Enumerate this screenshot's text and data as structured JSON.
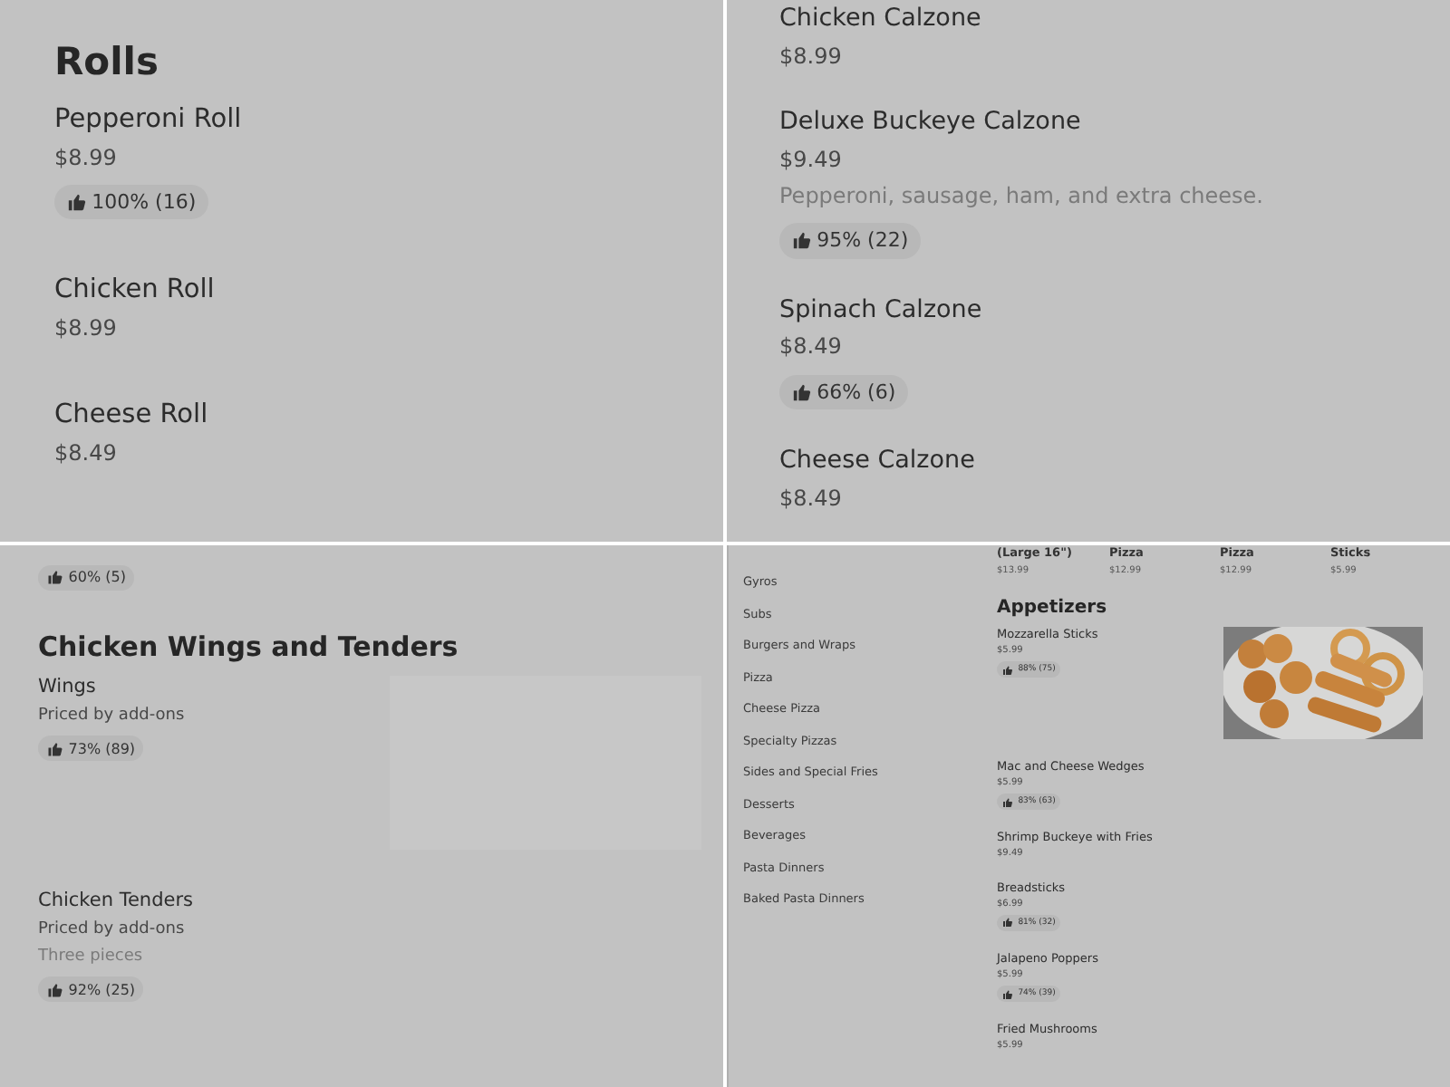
{
  "panels": [
    {
      "kind": "menu",
      "sections": [
        {
          "heading": "Rolls",
          "items": [
            {
              "name": "Pepperoni Roll",
              "price": "$8.99",
              "rating": "100% (16)"
            },
            {
              "name": "Chicken Roll",
              "price": "$8.99"
            },
            {
              "name": "Cheese Roll",
              "price": "$8.49"
            }
          ]
        }
      ]
    },
    {
      "kind": "menu",
      "sections": [
        {
          "items": [
            {
              "name": "Chicken Calzone",
              "price": "$8.99"
            },
            {
              "name": "Deluxe Buckeye Calzone",
              "price": "$9.49",
              "description": "Pepperoni, sausage, ham, and extra cheese.",
              "rating": "95% (22)"
            },
            {
              "name": "Spinach Calzone",
              "price": "$8.49",
              "rating": "66% (6)"
            },
            {
              "name": "Cheese Calzone",
              "price": "$8.49"
            }
          ]
        }
      ]
    },
    {
      "kind": "menu",
      "sections": [
        {
          "items": [
            {
              "rating": "60% (5)"
            }
          ]
        },
        {
          "heading": "Chicken Wings and Tenders",
          "items": [
            {
              "name": "Wings",
              "price": "Priced by add-ons",
              "rating": "73% (89)",
              "kind": "placeholder"
            },
            {
              "name": "Chicken Tenders",
              "price": "Priced by add-ons",
              "description": "Three pieces",
              "rating": "92% (25)"
            }
          ]
        }
      ]
    },
    {
      "kind": "sidebar_menu",
      "categories": [
        "Gyros",
        "Subs",
        "Burgers and Wraps",
        "Pizza",
        "Cheese Pizza",
        "Specialty Pizzas",
        "Sides and Special Fries",
        "Desserts",
        "Beverages",
        "Pasta Dinners",
        "Baked Pasta Dinners"
      ],
      "featured": [
        {
          "name": "(Large 16\")",
          "price": "$13.99"
        },
        {
          "name": "Pizza",
          "price": "$12.99"
        },
        {
          "name": "Pizza",
          "price": "$12.99"
        },
        {
          "name": "Sticks",
          "price": "$5.99"
        }
      ],
      "sections": [
        {
          "heading": "Appetizers",
          "items": [
            {
              "name": "Mozzarella Sticks",
              "price": "$5.99",
              "rating": "88% (75)",
              "kind": "picture"
            },
            {
              "name": "Mac and Cheese Wedges",
              "price": "$5.99",
              "rating": "83% (63)"
            },
            {
              "name": "Shrimp Buckeye with Fries",
              "price": "$9.49"
            },
            {
              "name": "Breadsticks",
              "price": "$6.99",
              "rating": "81% (32)"
            },
            {
              "name": "Jalapeno Poppers",
              "price": "$5.99",
              "rating": "74% (39)"
            },
            {
              "name": "Fried Mushrooms",
              "price": "$5.99"
            }
          ]
        }
      ]
    }
  ]
}
